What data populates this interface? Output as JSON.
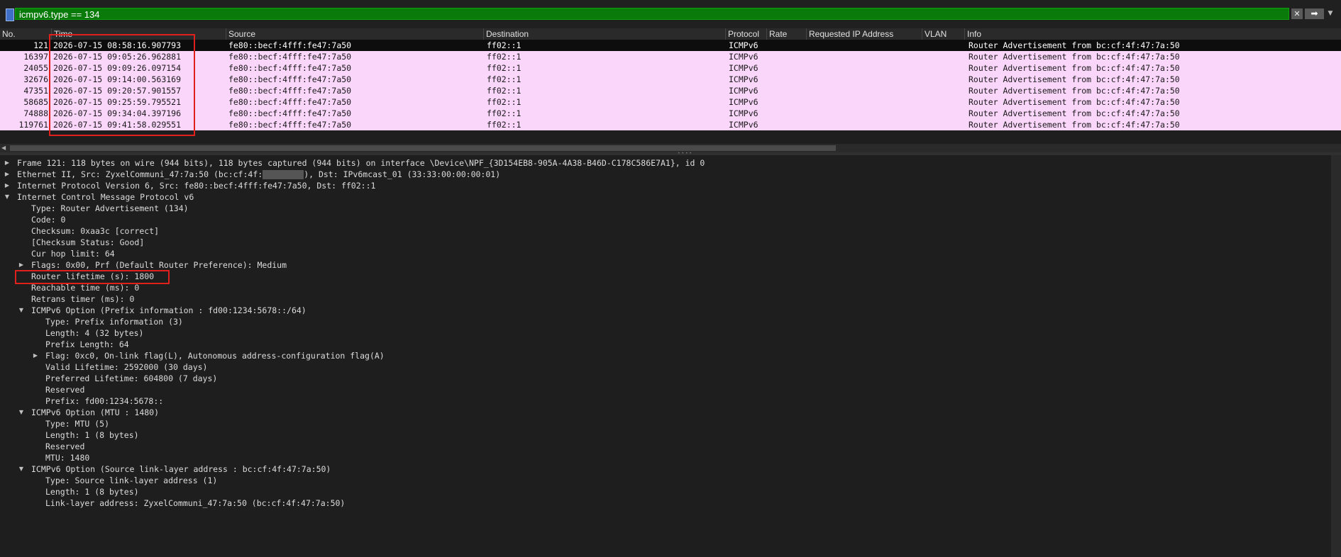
{
  "filter": {
    "value": "icmpv6.type == 134",
    "clear_icon": "clear-icon",
    "apply_icon": "arrow-right-icon",
    "dropdown_icon": "chevron-down-icon"
  },
  "columns": [
    "No.",
    "Time",
    "Source",
    "Destination",
    "Protocol",
    "Rate",
    "Requested IP Address",
    "VLAN",
    "Info"
  ],
  "packets": [
    {
      "no": "121",
      "time": "2026-07-15 08:58:16.907793",
      "src": "fe80::becf:4fff:fe47:7a50",
      "dst": "ff02::1",
      "proto": "ICMPv6",
      "info": "Router Advertisement from bc:cf:4f:47:7a:50"
    },
    {
      "no": "16397",
      "time": "2026-07-15 09:05:26.962881",
      "src": "fe80::becf:4fff:fe47:7a50",
      "dst": "ff02::1",
      "proto": "ICMPv6",
      "info": "Router Advertisement from bc:cf:4f:47:7a:50"
    },
    {
      "no": "24055",
      "time": "2026-07-15 09:09:26.097154",
      "src": "fe80::becf:4fff:fe47:7a50",
      "dst": "ff02::1",
      "proto": "ICMPv6",
      "info": "Router Advertisement from bc:cf:4f:47:7a:50"
    },
    {
      "no": "32676",
      "time": "2026-07-15 09:14:00.563169",
      "src": "fe80::becf:4fff:fe47:7a50",
      "dst": "ff02::1",
      "proto": "ICMPv6",
      "info": "Router Advertisement from bc:cf:4f:47:7a:50"
    },
    {
      "no": "47351",
      "time": "2026-07-15 09:20:57.901557",
      "src": "fe80::becf:4fff:fe47:7a50",
      "dst": "ff02::1",
      "proto": "ICMPv6",
      "info": "Router Advertisement from bc:cf:4f:47:7a:50"
    },
    {
      "no": "58685",
      "time": "2026-07-15 09:25:59.795521",
      "src": "fe80::becf:4fff:fe47:7a50",
      "dst": "ff02::1",
      "proto": "ICMPv6",
      "info": "Router Advertisement from bc:cf:4f:47:7a:50"
    },
    {
      "no": "74888",
      "time": "2026-07-15 09:34:04.397196",
      "src": "fe80::becf:4fff:fe47:7a50",
      "dst": "ff02::1",
      "proto": "ICMPv6",
      "info": "Router Advertisement from bc:cf:4f:47:7a:50"
    },
    {
      "no": "119761",
      "time": "2026-07-15 09:41:58.029551",
      "src": "fe80::becf:4fff:fe47:7a50",
      "dst": "ff02::1",
      "proto": "ICMPv6",
      "info": "Router Advertisement from bc:cf:4f:47:7a:50"
    }
  ],
  "details": {
    "frame": "Frame 121: 118 bytes on wire (944 bits), 118 bytes captured (944 bits) on interface \\Device\\NPF_{3D154EB8-905A-4A38-B46D-C178C586E7A1}, id 0",
    "eth_a": "Ethernet II, Src: ZyxelCommuni_47:7a:50 (bc:cf:4f:",
    "eth_b": "), Dst: IPv6mcast_01 (33:33:00:00:00:01)",
    "ipv6": "Internet Protocol Version 6, Src: fe80::becf:4fff:fe47:7a50, Dst: ff02::1",
    "icmp": "Internet Control Message Protocol v6",
    "type": "Type: Router Advertisement (134)",
    "code": "Code: 0",
    "checksum": "Checksum: 0xaa3c [correct]",
    "checksum_status": "[Checksum Status: Good]",
    "hop": "Cur hop limit: 64",
    "flags": "Flags: 0x00, Prf (Default Router Preference): Medium",
    "lifetime": "Router lifetime (s): 1800",
    "reachable": "Reachable time (ms): 0",
    "retrans": "Retrans timer (ms): 0",
    "opt_prefix": "ICMPv6 Option (Prefix information : fd00:1234:5678::/64)",
    "p_type": "Type: Prefix information (3)",
    "p_len": "Length: 4 (32 bytes)",
    "p_plen": "Prefix Length: 64",
    "p_flag": "Flag: 0xc0, On-link flag(L), Autonomous address-configuration flag(A)",
    "p_valid": "Valid Lifetime: 2592000 (30 days)",
    "p_pref": "Preferred Lifetime: 604800 (7 days)",
    "p_res": "Reserved",
    "p_prefix": "Prefix: fd00:1234:5678::",
    "opt_mtu": "ICMPv6 Option (MTU : 1480)",
    "m_type": "Type: MTU (5)",
    "m_len": "Length: 1 (8 bytes)",
    "m_res": "Reserved",
    "m_mtu": "MTU: 1480",
    "opt_sll": "ICMPv6 Option (Source link-layer address : bc:cf:4f:47:7a:50)",
    "s_type": "Type: Source link-layer address (1)",
    "s_len": "Length: 1 (8 bytes)",
    "s_addr": "Link-layer address: ZyxelCommuni_47:7a:50 (bc:cf:4f:47:7a:50)"
  },
  "colors": {
    "filter_valid": "#0a7a0a",
    "row_icmpv6": "#fad6fa",
    "row_selected": "#0d0d0d",
    "annotation": "#e0201c"
  }
}
